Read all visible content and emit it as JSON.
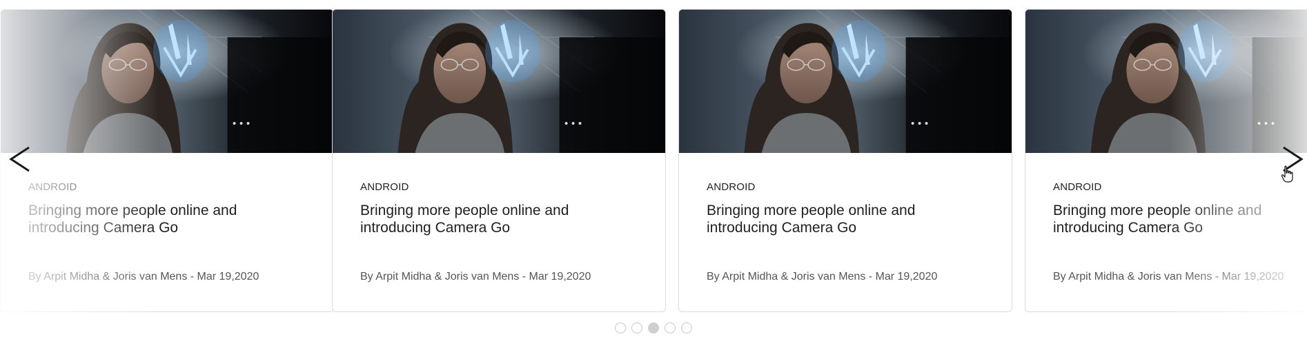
{
  "carousel": {
    "cards": [
      {
        "tag": "ANDROID",
        "title": "Bringing more people online and introducing Camera Go",
        "byline": "By Arpit Midha & Joris van Mens - Mar 19,2020"
      },
      {
        "tag": "ANDROID",
        "title": "Bringing more people online and introducing Camera Go",
        "byline": "By Arpit Midha & Joris van Mens - Mar 19,2020"
      },
      {
        "tag": "ANDROID",
        "title": "Bringing more people online and introducing Camera Go",
        "byline": "By Arpit Midha & Joris van Mens - Mar 19,2020"
      },
      {
        "tag": "ANDROID",
        "title": "Bringing more people online and introducing Camera Go",
        "byline": "By Arpit Midha & Joris van Mens - Mar 19,2020"
      }
    ],
    "prev_icon": "chevron-left-icon",
    "next_icon": "chevron-right-icon",
    "pagination": {
      "total": 5,
      "active_index": 2
    }
  },
  "colors": {
    "card_border": "#dcdcdc",
    "dot_active": "#cfcfcf",
    "dot_border": "#c7c7c7",
    "title_text": "#1f1f1f",
    "byline_text": "#555555"
  }
}
